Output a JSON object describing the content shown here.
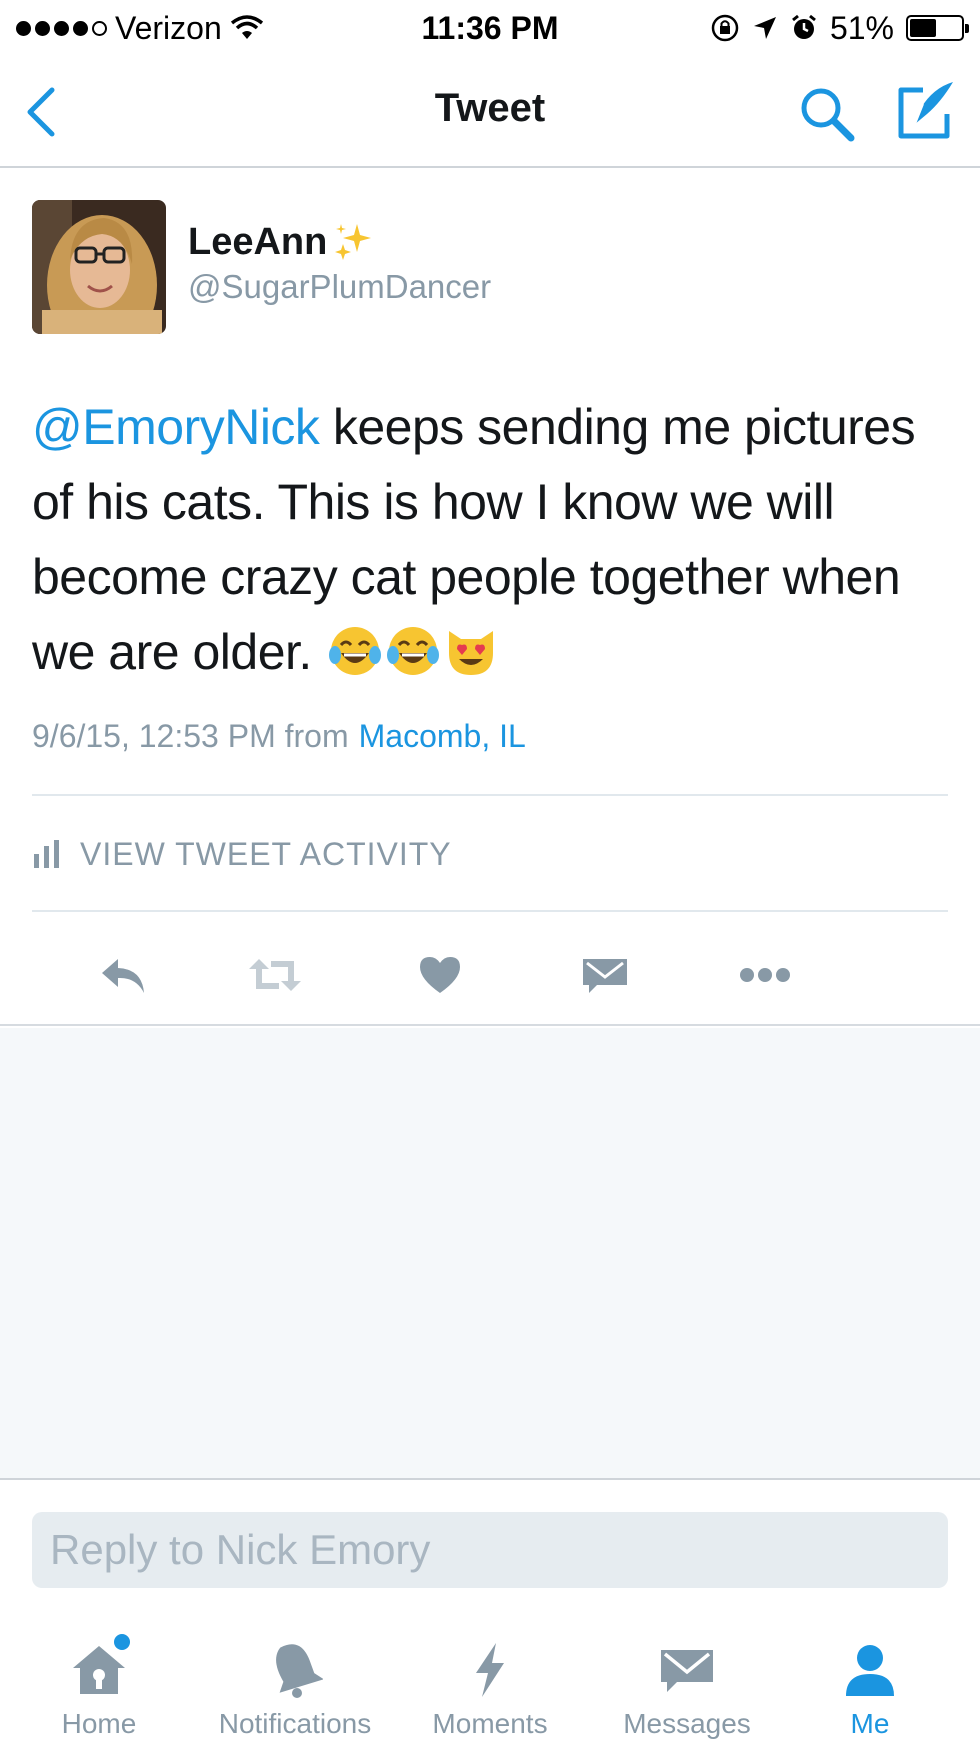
{
  "status_bar": {
    "carrier": "Verizon",
    "time": "11:36 PM",
    "battery_percent": "51%",
    "battery_level": 0.51
  },
  "nav": {
    "title": "Tweet"
  },
  "tweet": {
    "author_name": "LeeAnn",
    "author_handle": "@SugarPlumDancer",
    "mention": "@EmoryNick",
    "body": " keeps sending me pictures of his cats. This is how I know we will become crazy cat people together when we are older. ",
    "timestamp": "9/6/15, 12:53 PM from",
    "location": "Macomb, IL",
    "activity_label": "VIEW TWEET ACTIVITY"
  },
  "reply": {
    "placeholder": "Reply to Nick Emory"
  },
  "tabs": [
    {
      "label": "Home",
      "icon": "home-icon"
    },
    {
      "label": "Notifications",
      "icon": "bell-icon"
    },
    {
      "label": "Moments",
      "icon": "lightning-icon"
    },
    {
      "label": "Messages",
      "icon": "envelope-icon"
    },
    {
      "label": "Me",
      "icon": "person-icon"
    }
  ],
  "colors": {
    "accent": "#1b95e0",
    "muted": "#8899a6",
    "background_empty": "#f5f8fa"
  }
}
